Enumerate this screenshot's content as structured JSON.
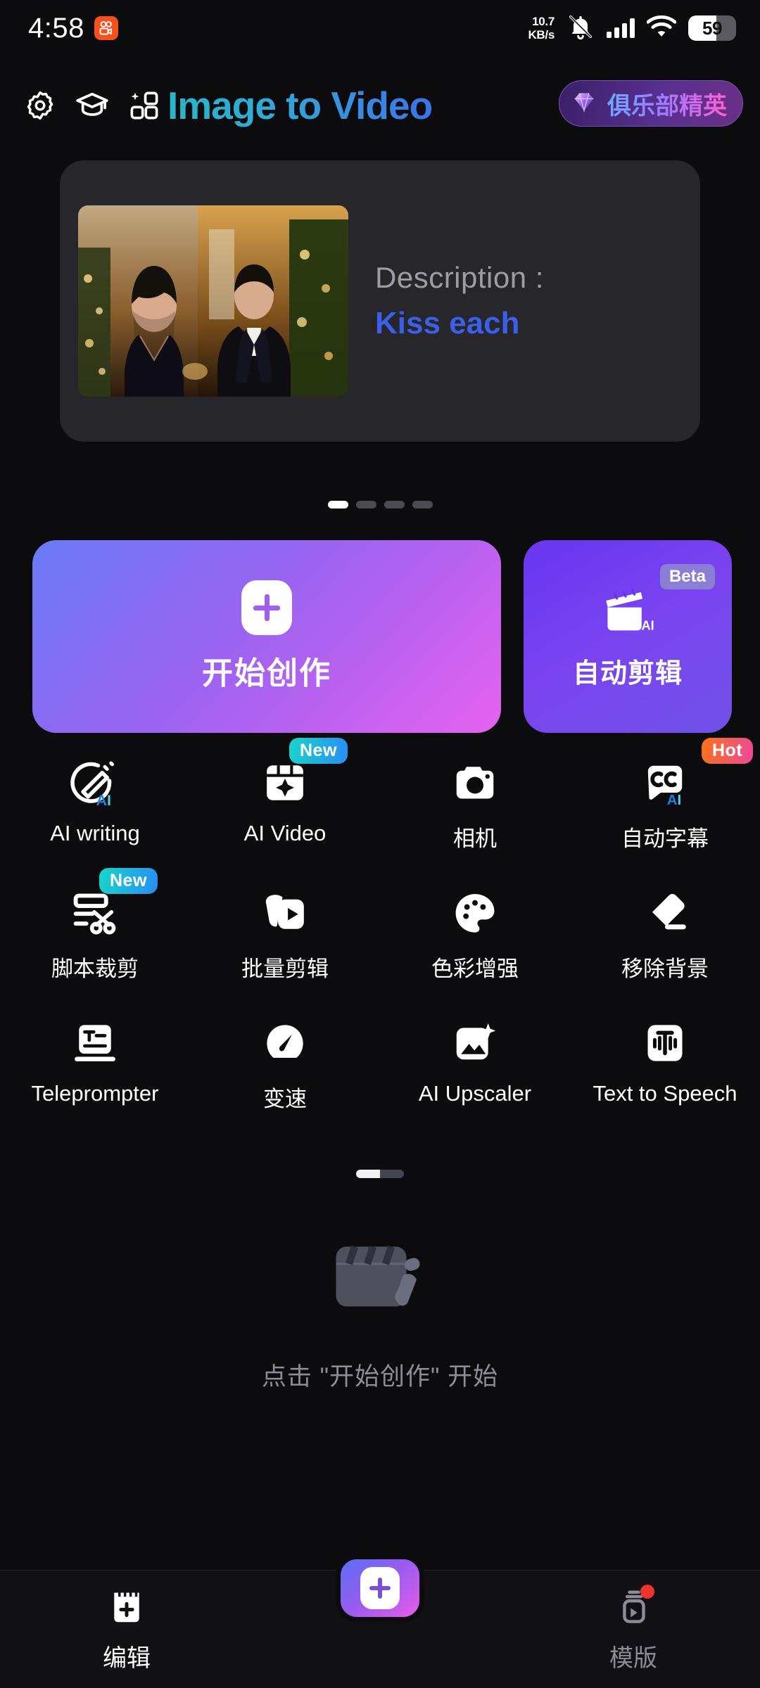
{
  "status_bar": {
    "time": "4:58",
    "app_icon": "video-app-icon",
    "net_speed_value": "10.7",
    "net_speed_unit": "KB/s",
    "mute_icon": "bell-muted-icon",
    "signal_icon": "cellular-signal-icon",
    "wifi_icon": "wifi-icon",
    "battery_percent": "59",
    "battery_level": 59
  },
  "header": {
    "settings_icon": "gear-icon",
    "tutorial_icon": "graduation-cap-icon",
    "sparkle_grid_icon": "sparkle-grid-icon",
    "title": "Image to Video",
    "vip_badge": {
      "icon": "diamond-gem-icon",
      "label": "俱乐部精英"
    }
  },
  "banner": {
    "description_label": "Description :",
    "description_value": "Kiss each",
    "thumbnail": "couple-christmas-photo"
  },
  "carousel": {
    "total": 4,
    "active_index": 0
  },
  "primary_actions": {
    "create": {
      "icon": "plus-icon",
      "label": "开始创作"
    },
    "auto_edit": {
      "icon": "clapperboard-ai-icon",
      "label": "自动剪辑",
      "badge": "Beta"
    }
  },
  "tools": [
    {
      "icon": "ai-pen-icon",
      "label": "AI writing",
      "badge": null,
      "badge_type": null
    },
    {
      "icon": "film-sparkle-icon",
      "label": "AI Video",
      "badge": "New",
      "badge_type": "new"
    },
    {
      "icon": "camera-icon",
      "label": "相机",
      "badge": null,
      "badge_type": null
    },
    {
      "icon": "cc-ai-icon",
      "label": "自动字幕",
      "badge": "Hot",
      "badge_type": "hot"
    },
    {
      "icon": "script-scissors-icon",
      "label": "脚本裁剪",
      "badge": "New",
      "badge_type": "new"
    },
    {
      "icon": "batch-play-icon",
      "label": "批量剪辑",
      "badge": null,
      "badge_type": null
    },
    {
      "icon": "palette-icon",
      "label": "色彩增强",
      "badge": null,
      "badge_type": null
    },
    {
      "icon": "eraser-icon",
      "label": "移除背景",
      "badge": null,
      "badge_type": null
    },
    {
      "icon": "teleprompter-icon",
      "label": "Teleprompter",
      "badge": null,
      "badge_type": null
    },
    {
      "icon": "speedometer-icon",
      "label": "变速",
      "badge": null,
      "badge_type": null
    },
    {
      "icon": "image-sparkle-icon",
      "label": "AI Upscaler",
      "badge": null,
      "badge_type": null
    },
    {
      "icon": "text-speech-icon",
      "label": "Text to Speech",
      "badge": null,
      "badge_type": null
    }
  ],
  "tool_pager": {
    "total": 2,
    "active_index": 0
  },
  "empty_state": {
    "icon": "clapperboard-pen-icon",
    "text": "点击 \"开始创作\" 开始"
  },
  "bottom_nav": {
    "edit": {
      "icon": "clapper-plus-icon",
      "label": "编辑",
      "active": true
    },
    "fab": {
      "icon": "plus-icon"
    },
    "template": {
      "icon": "template-play-icon",
      "label": "模版",
      "active": false,
      "has_dot": true
    }
  },
  "colors": {
    "background": "#0c0c0f",
    "card": "#26262b",
    "accent_blue": "#3b5fe8",
    "accent_purple": "#9a63f0",
    "accent_pink": "#e562ef",
    "badge_new": "#2a8cf5",
    "badge_hot": "#ec4899",
    "red_dot": "#f0322e"
  }
}
